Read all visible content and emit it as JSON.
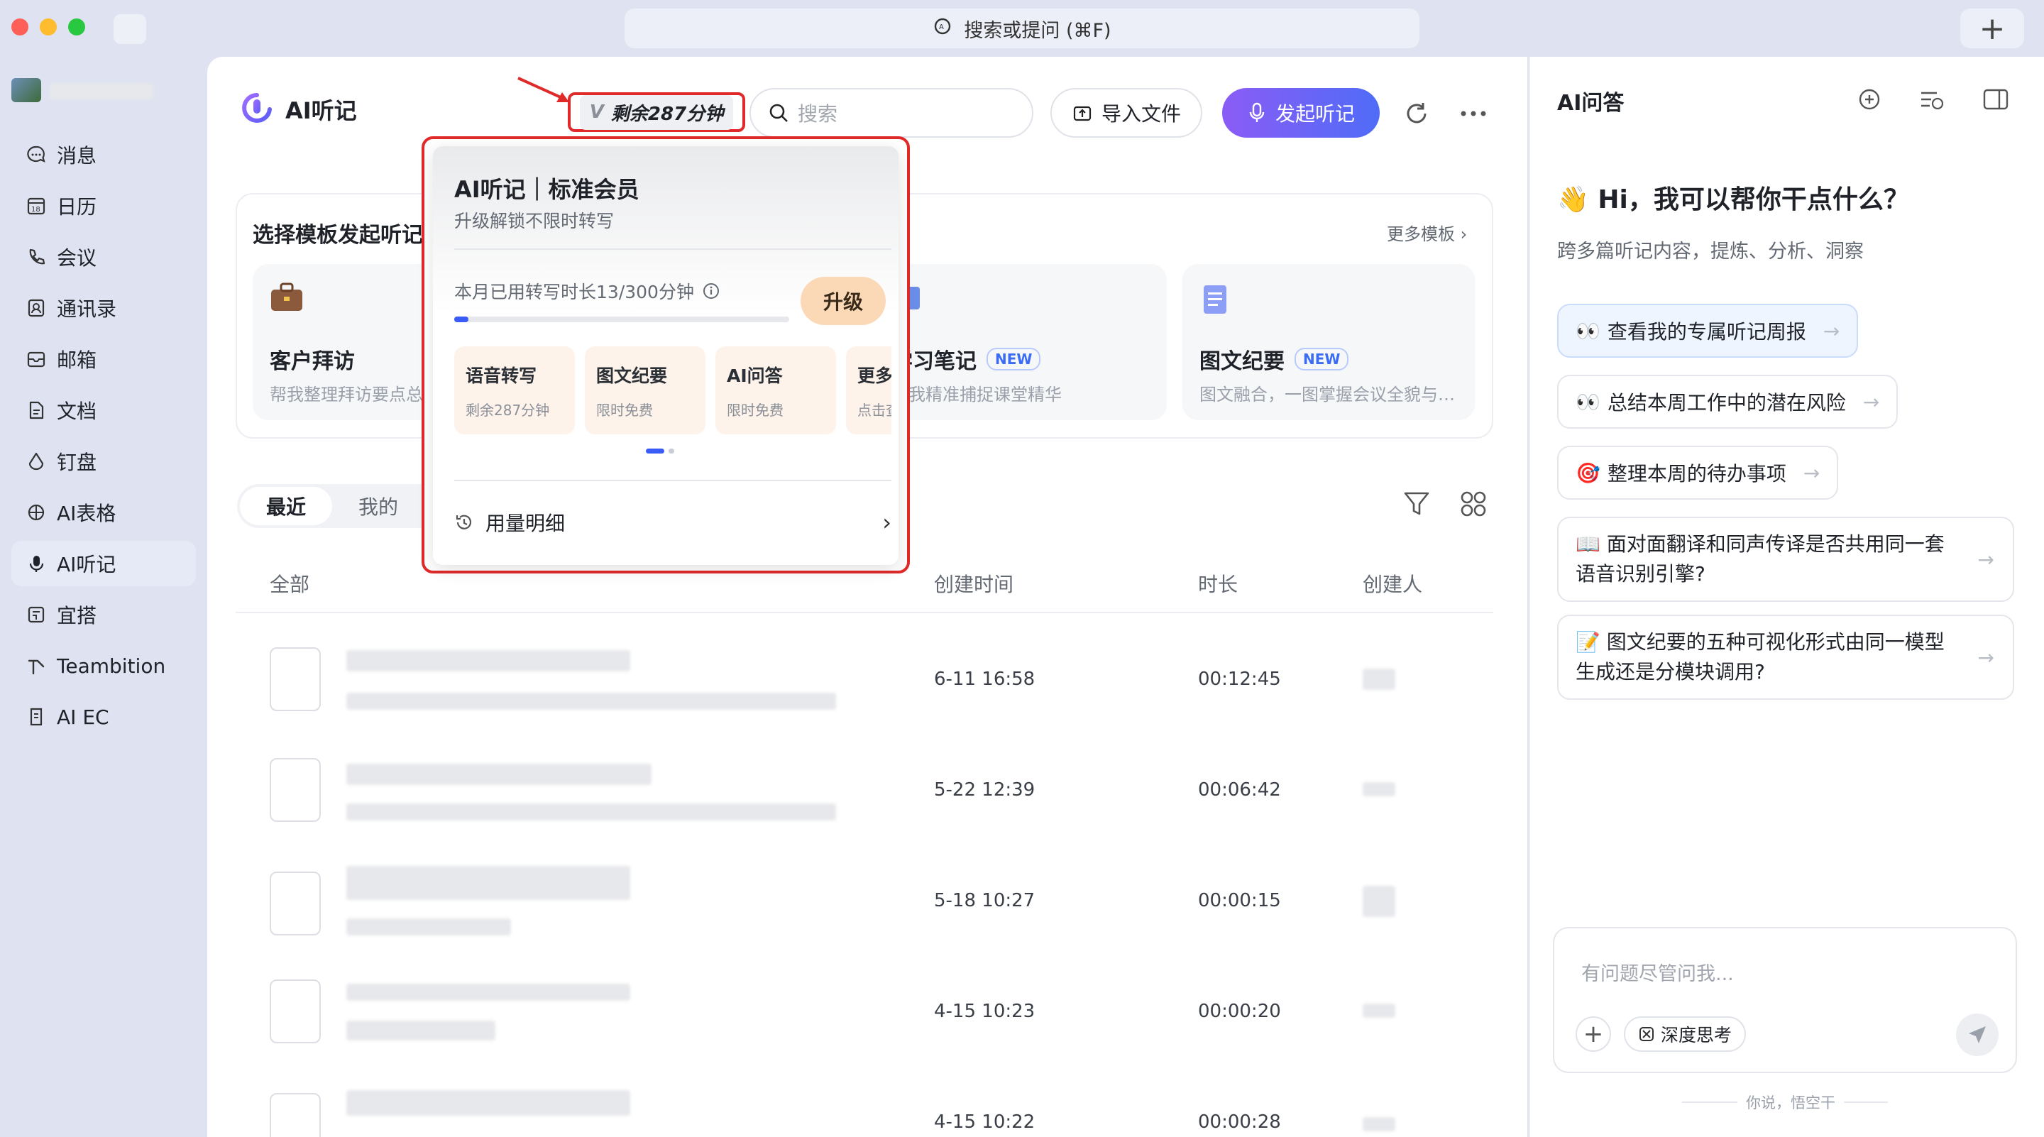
{
  "titlebar": {
    "search_text": "搜索或提问 (⌘F)",
    "new_tab": "+"
  },
  "sidebar": {
    "items": [
      {
        "label": "消息"
      },
      {
        "label": "日历"
      },
      {
        "label": "会议"
      },
      {
        "label": "通讯录"
      },
      {
        "label": "邮箱"
      },
      {
        "label": "文档"
      },
      {
        "label": "钉盘"
      },
      {
        "label": "AI表格"
      },
      {
        "label": "AI听记"
      },
      {
        "label": "宜搭"
      },
      {
        "label": "Teambition"
      },
      {
        "label": "AI EC"
      }
    ],
    "calendar_day": "18"
  },
  "header": {
    "title": "AI听记",
    "badge_v": "V",
    "badge_text": "剩余287分钟",
    "search_placeholder": "搜索",
    "import_label": "导入文件",
    "start_label": "发起听记"
  },
  "templates": {
    "heading": "选择模板发起听记",
    "more": "更多模板 ›",
    "cards": [
      {
        "name": "客户拜访",
        "desc": "帮我整理拜访要点总结"
      },
      {
        "name": "学习笔记",
        "new": "NEW",
        "desc": "帮我精准捕捉课堂精华"
      },
      {
        "name": "图文纪要",
        "new": "NEW",
        "desc": "图文融合，一图掌握会议全貌与…"
      }
    ]
  },
  "tabs": {
    "recent": "最近",
    "mine": "我的"
  },
  "table": {
    "headers": {
      "all": "全部",
      "created": "创建时间",
      "duration": "时长",
      "creator": "创建人"
    },
    "rows": [
      {
        "created": "6-11 16:58",
        "duration": "00:12:45"
      },
      {
        "created": "5-22 12:39",
        "duration": "00:06:42"
      },
      {
        "created": "5-18 10:27",
        "duration": "00:00:15"
      },
      {
        "created": "4-15 10:23",
        "duration": "00:00:20"
      },
      {
        "created": "4-15 10:22",
        "duration": "00:00:28"
      }
    ]
  },
  "popup": {
    "title": "AI听记｜标准会员",
    "subtitle": "升级解锁不限时转写",
    "usage_label": "本月已用转写时长13/300分钟",
    "usage_used": 13,
    "usage_total": 300,
    "upgrade": "升级",
    "features": [
      {
        "title": "语音转写",
        "sub": "剩余287分钟"
      },
      {
        "title": "图文纪要",
        "sub": "限时免费"
      },
      {
        "title": "AI问答",
        "sub": "限时免费"
      },
      {
        "title": "更多",
        "sub": "点击查"
      }
    ],
    "detail": "用量明细"
  },
  "qa": {
    "title": "AI问答",
    "greeting": "👋 Hi，我可以帮你干点什么？",
    "sub": "跨多篇听记内容，提炼、分析、洞察",
    "chips": [
      {
        "icon": "👀",
        "text": "查看我的专属听记周报"
      },
      {
        "icon": "👀",
        "text": "总结本周工作中的潜在风险"
      },
      {
        "icon": "🎯",
        "text": "整理本周的待办事项"
      },
      {
        "icon": "📖",
        "text": "面对面翻译和同声传译是否共用同一套语音识别引擎?"
      },
      {
        "icon": "📝",
        "text": "图文纪要的五种可视化形式由同一模型生成还是分模块调用?"
      }
    ],
    "input_placeholder": "有问题尽管问我...",
    "deep_think": "深度思考",
    "footer": "你说，悟空干"
  },
  "colors": {
    "accent": "#5b5ef7",
    "red_highlight": "#e02a2a",
    "upgrade_bg": "#fbd8b6"
  }
}
